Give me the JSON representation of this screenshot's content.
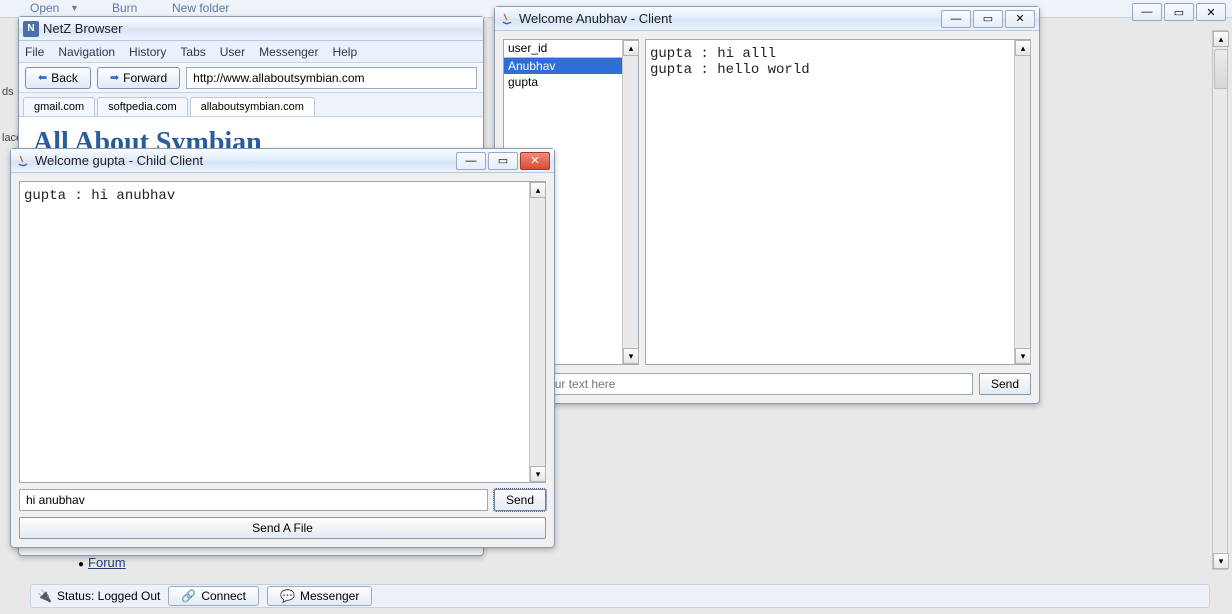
{
  "bg_toolbar": {
    "open": "Open",
    "burn": "Burn",
    "newfolder": "New folder"
  },
  "browser": {
    "title": "NetZ Browser",
    "menu": [
      "File",
      "Navigation",
      "History",
      "Tabs",
      "User",
      "Messenger",
      "Help"
    ],
    "back_label": "Back",
    "forward_label": "Forward",
    "url": "http://www.allaboutsymbian.com",
    "tabs": [
      "gmail.com",
      "softpedia.com",
      "allaboutsymbian.com"
    ],
    "page_heading": "All About Symbian"
  },
  "forum_link": "Forum",
  "status": {
    "label": "Status: Logged Out",
    "connect": "Connect",
    "messenger": "Messenger"
  },
  "anubhav": {
    "title": "Welcome Anubhav - Client",
    "userlist_header": "user_id",
    "users": [
      "Anubhav",
      "gupta"
    ],
    "selected_index": 0,
    "chat_lines": [
      "gupta : hi alll",
      "gupta : hello world"
    ],
    "input_placeholder": "Enter your text here",
    "send_label": "Send"
  },
  "gupta": {
    "title": "Welcome gupta - Child Client",
    "chat_lines": [
      "gupta : hi anubhav"
    ],
    "input_value": "hi anubhav",
    "send_label": "Send",
    "sendfile_label": "Send A File"
  },
  "left_ghosts": {
    "ds": "ds",
    "lace": "lace"
  }
}
